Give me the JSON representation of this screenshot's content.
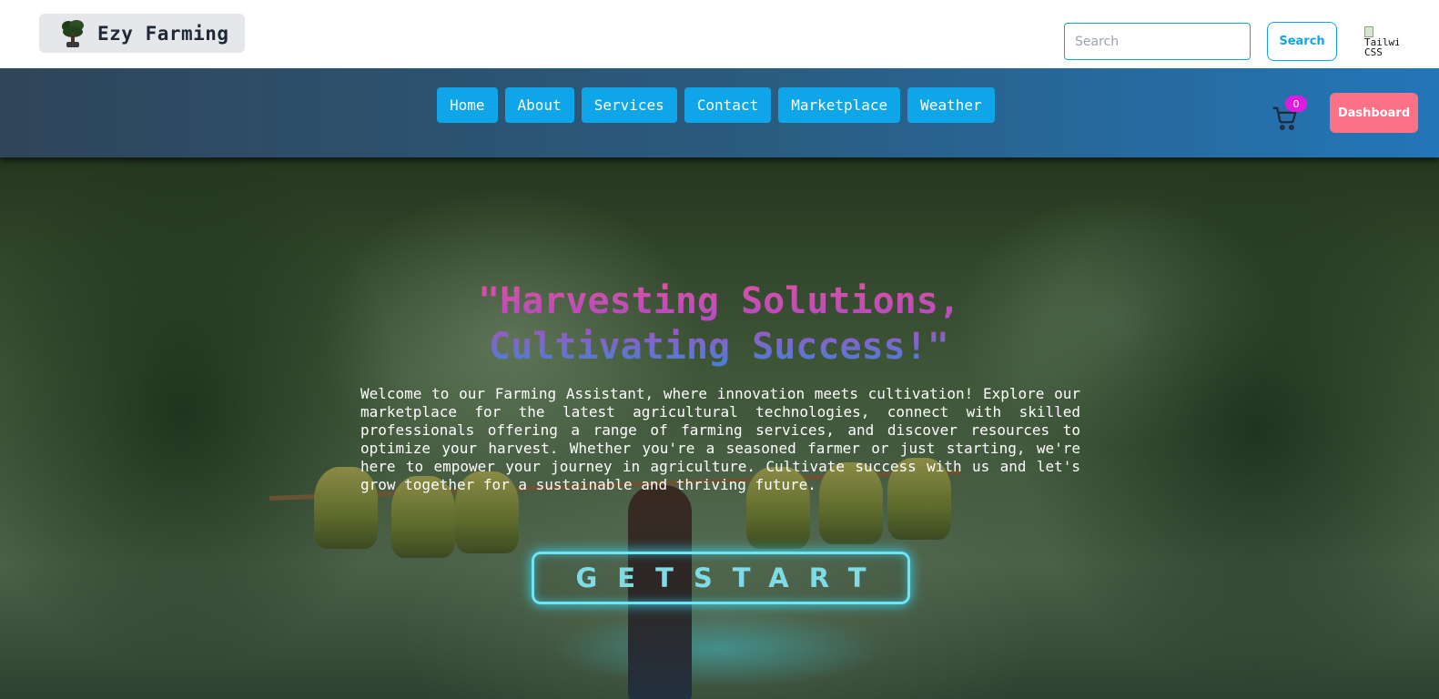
{
  "header": {
    "brand_name": "Ezy Farming",
    "search": {
      "placeholder": "Search",
      "value": "",
      "button_label": "Search"
    },
    "avatar_alt": "Tailwind CSS"
  },
  "nav": {
    "links": [
      "Home",
      "About",
      "Services",
      "Contact",
      "Marketplace",
      "Weather"
    ],
    "cart_count": "0",
    "dashboard_label": "Dashboard"
  },
  "hero": {
    "title_line1": "\"Harvesting Solutions,",
    "title_line2": "Cultivating Success!\"",
    "description": "Welcome to our Farming Assistant, where innovation meets cultivation! Explore our marketplace for the latest agricultural technologies, connect with skilled professionals offering a range of farming services, and discover resources to optimize your harvest. Whether you're a seasoned farmer or just starting, we're here to empower your journey in agriculture. Cultivate success with us and let's grow together for a sustainable and thriving future.",
    "cta_label": "GETSTART"
  },
  "colors": {
    "nav_button": "#0ea5e9",
    "dashboard_button": "#fb7185",
    "cart_badge": "#e01be0",
    "cta_glow": "#6fe4f4",
    "title_gradient_top": "#e052a0",
    "title_gradient_bottom": "#3f86d6"
  },
  "icons": {
    "brand": "tree-icon",
    "cart": "cart-icon"
  }
}
